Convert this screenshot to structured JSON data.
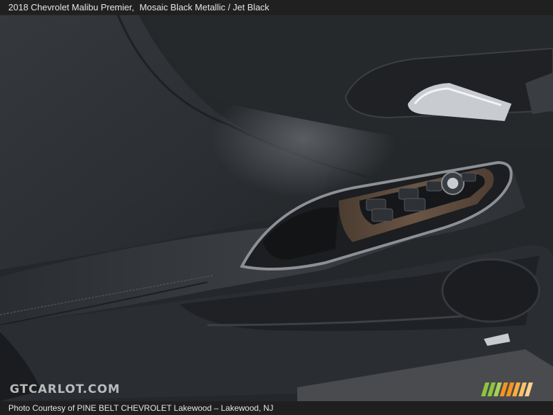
{
  "caption": {
    "vehicle": "2018 Chevrolet Malibu Premier,",
    "colors": "Mosaic Black Metallic / Jet Black"
  },
  "credit": "Photo Courtesy of PINE BELT CHEVROLET Lakewood – Lakewood, NJ",
  "watermark": "GTCARLOT.COM",
  "colors": {
    "panel": "#3a3d41",
    "leather": "#2b2d30",
    "trim": "#6a6b6d",
    "wood": "#5a4a3e",
    "stripe_green": "#8cc63f",
    "stripe_orange": "#f7941d"
  },
  "icons": [
    "door-handle-icon",
    "window-switch-icon",
    "mirror-control-icon",
    "gtcarlot-logo-stripes"
  ]
}
